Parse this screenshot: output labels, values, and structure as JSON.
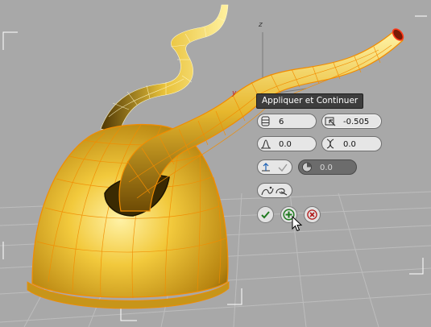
{
  "viewport": {
    "axis_z_label": "z",
    "axis_y_label": "y"
  },
  "tooltip": {
    "text": "Appliquer et Continuer"
  },
  "caddy": {
    "segments_value": "6",
    "taper_amount_value": "-0.505",
    "taper_curve_value": "0.0",
    "twist_value": "0.0",
    "angle_value": "0.0"
  },
  "buttons": {
    "ok": "ok-check-icon",
    "apply_continue": "apply-and-continue-plus-icon",
    "cancel": "cancel-x-icon"
  },
  "colors": {
    "mesh": "#e2b52a",
    "wire": "#f28c00",
    "selection_edge": "#ff3a1a",
    "viewport_bg": "#a8a8a8",
    "grid": "#bdbdbd"
  }
}
